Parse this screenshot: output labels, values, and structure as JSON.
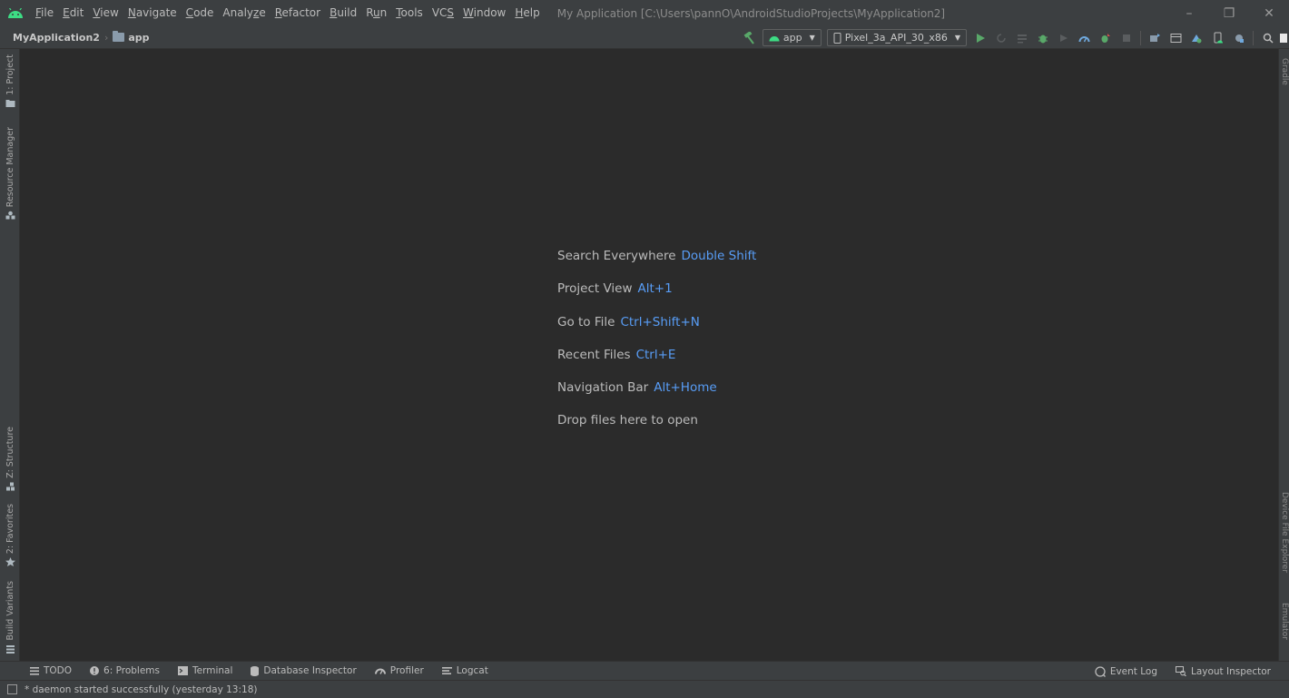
{
  "menu": {
    "items": [
      {
        "pre": "",
        "u": "F",
        "post": "ile"
      },
      {
        "pre": "",
        "u": "E",
        "post": "dit"
      },
      {
        "pre": "",
        "u": "V",
        "post": "iew"
      },
      {
        "pre": "",
        "u": "N",
        "post": "avigate"
      },
      {
        "pre": "",
        "u": "C",
        "post": "ode"
      },
      {
        "pre": "Analy",
        "u": "z",
        "post": "e"
      },
      {
        "pre": "",
        "u": "R",
        "post": "efactor"
      },
      {
        "pre": "",
        "u": "B",
        "post": "uild"
      },
      {
        "pre": "R",
        "u": "u",
        "post": "n"
      },
      {
        "pre": "",
        "u": "T",
        "post": "ools"
      },
      {
        "pre": "VC",
        "u": "S",
        "post": ""
      },
      {
        "pre": "",
        "u": "W",
        "post": "indow"
      },
      {
        "pre": "",
        "u": "H",
        "post": "elp"
      }
    ]
  },
  "window": {
    "title": "My Application [C:\\Users\\pannO\\AndroidStudioProjects\\MyApplication2]",
    "minimize": "–",
    "restore": "❐",
    "close": "✕"
  },
  "navbar": {
    "project": "MyApplication2",
    "module": "app",
    "run_config": "app",
    "device": "Pixel_3a_API_30_x86"
  },
  "left_tabs": {
    "project": "1: Project",
    "resource_manager": "Resource Manager",
    "structure": "Z: Structure",
    "favorites": "2: Favorites",
    "build_variants": "Build Variants"
  },
  "right_tabs": {
    "gradle": "Gradle",
    "device_file_explorer": "Device File Explorer",
    "emulator": "Emulator"
  },
  "hints": [
    {
      "label": "Search Everywhere",
      "key": "Double Shift"
    },
    {
      "label": "Project View",
      "key": "Alt+1"
    },
    {
      "label": "Go to File",
      "key": "Ctrl+Shift+N"
    },
    {
      "label": "Recent Files",
      "key": "Ctrl+E"
    },
    {
      "label": "Navigation Bar",
      "key": "Alt+Home"
    },
    {
      "label": "Drop files here to open",
      "key": ""
    }
  ],
  "bottom_tools": {
    "todo": "TODO",
    "problems": "6: Problems",
    "terminal": "Terminal",
    "database_inspector": "Database Inspector",
    "profiler": "Profiler",
    "logcat": "Logcat",
    "event_log": "Event Log",
    "layout_inspector": "Layout Inspector"
  },
  "status": {
    "message": "* daemon started successfully (yesterday 13:18)"
  },
  "colors": {
    "accent_key": "#589df6",
    "android_green": "#3ddc84",
    "run_green": "#59a869"
  }
}
